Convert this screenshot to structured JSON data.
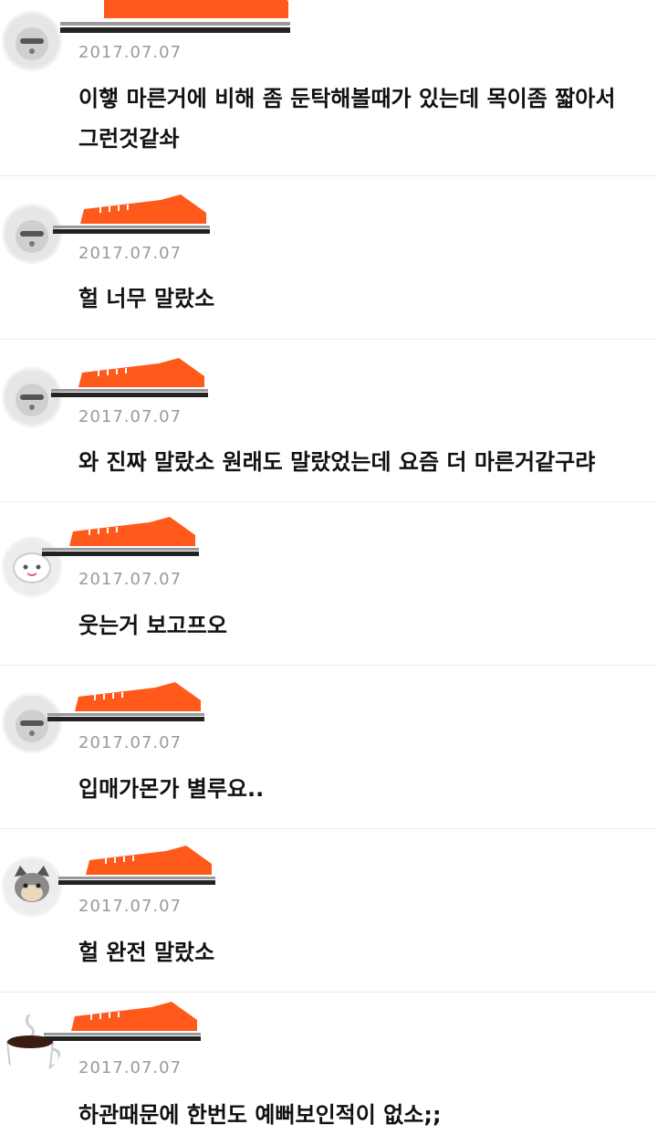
{
  "colors": {
    "sneaker_orange": "#ff5a1c",
    "date_gray": "#9a9a9a",
    "text_black": "#111111",
    "divider": "#ececec"
  },
  "comments": [
    {
      "avatar": "user-avatar-character-icon",
      "date": "2017.07.07",
      "text": "이햏 마른거에 비해 좀 둔탁해볼때가 있는데 목이좀 짧아서 그런것같솨"
    },
    {
      "avatar": "user-avatar-character-icon",
      "date": "2017.07.07",
      "text": "헐 너무 말랐소"
    },
    {
      "avatar": "user-avatar-character-icon",
      "date": "2017.07.07",
      "text": "와 진짜 말랐소 원래도 말랐었는데 요즘 더 마른거같구랴"
    },
    {
      "avatar": "user-avatar-character-icon",
      "date": "2017.07.07",
      "text": "웃는거 보고프오"
    },
    {
      "avatar": "user-avatar-character-icon",
      "date": "2017.07.07",
      "text": "입매가몬가 별루요.."
    },
    {
      "avatar": "user-avatar-cat-icon",
      "date": "2017.07.07",
      "text": "헐 완전 말랐소"
    },
    {
      "avatar": "user-avatar-coffee-cup-icon",
      "date": "2017.07.07",
      "text": "하관때문에 한번도 예뻐보인적이 없소;;"
    }
  ]
}
